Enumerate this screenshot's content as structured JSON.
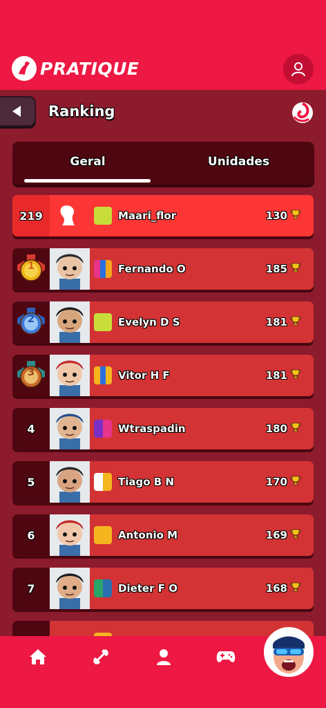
{
  "app": {
    "brand": "PRATIQUE"
  },
  "header": {
    "title": "Ranking"
  },
  "tabs": [
    {
      "label": "Geral",
      "active": true
    },
    {
      "label": "Unidades",
      "active": false
    }
  ],
  "me": {
    "rank": "219",
    "name": "Maari_flor",
    "score": "130"
  },
  "rows": [
    {
      "rank": "1",
      "medal": "gold",
      "name": "Fernando O",
      "score": "185",
      "colors": [
        "#e8348a",
        "#2a6fe0",
        "#f5a61e"
      ]
    },
    {
      "rank": "2",
      "medal": "silver",
      "name": "Evelyn D S",
      "score": "181",
      "colors": [
        "#c9dd3a"
      ]
    },
    {
      "rank": "3",
      "medal": "bronze",
      "name": "Vitor H F",
      "score": "181",
      "colors": [
        "#f5b51e",
        "#2a6fe0",
        "#f5b51e"
      ]
    },
    {
      "rank": "4",
      "name": "Wtraspadin",
      "score": "180",
      "colors": [
        "#7b2fc4",
        "#e8348a"
      ]
    },
    {
      "rank": "5",
      "name": "Tiago B N",
      "score": "170",
      "colors": [
        "#ffffff",
        "#f5b51e"
      ]
    },
    {
      "rank": "6",
      "name": "Antonio M",
      "score": "169",
      "colors": [
        "#f5b51e"
      ]
    },
    {
      "rank": "7",
      "name": "Dieter F O",
      "score": "168",
      "colors": [
        "#2aa56a",
        "#2a6fb0"
      ]
    }
  ],
  "colors": {
    "primary": "#ed1843",
    "background": "#8c1b2e",
    "row": "#d33334",
    "row_me": "#fb3635",
    "dark": "#4e0710"
  },
  "nav": [
    "home-icon",
    "dumbbell-icon",
    "user-icon",
    "gamepad-icon"
  ]
}
